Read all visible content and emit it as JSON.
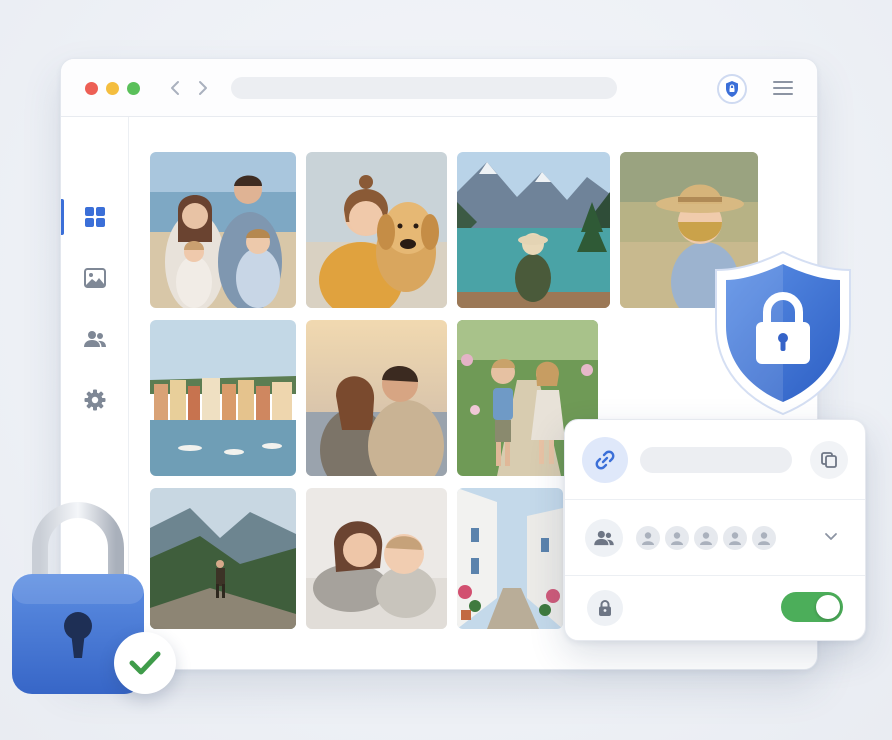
{
  "browser": {
    "traffic_lights": [
      "close",
      "minimize",
      "maximize"
    ],
    "traffic_light_colors": [
      "#ed5f55",
      "#f4be3f",
      "#5ac05a"
    ],
    "back_icon": "chevron-left-icon",
    "forward_icon": "chevron-right-icon",
    "address_text": "",
    "security_icon": "shield-lock-icon",
    "menu_icon": "hamburger-icon"
  },
  "sidebar": {
    "items": [
      {
        "icon": "grid-icon",
        "active": true
      },
      {
        "icon": "image-icon",
        "active": false
      },
      {
        "icon": "people-icon",
        "active": false
      },
      {
        "icon": "gear-icon",
        "active": false
      }
    ],
    "active_color": "#3b6fd8"
  },
  "gallery": {
    "photos": [
      {
        "subject": "family-on-beach"
      },
      {
        "subject": "girl-with-golden-retriever"
      },
      {
        "subject": "child-at-mountain-lake"
      },
      {
        "subject": "child-in-straw-hat-in-meadow"
      },
      {
        "subject": "coastal-village-harbor"
      },
      {
        "subject": "couple-at-sunset"
      },
      {
        "subject": "children-walking-on-garden-path"
      },
      {
        "subject": "hiker-on-mountain-ridge"
      },
      {
        "subject": "siblings-on-bed"
      },
      {
        "subject": "whitewashed-village-street"
      }
    ]
  },
  "share_panel": {
    "link_icon": "link-icon",
    "link_text": "",
    "copy_icon": "copy-icon",
    "people_icon": "people-icon",
    "avatar_count": 5,
    "expand_icon": "chevron-down-icon",
    "lock_icon": "lock-icon",
    "private_toggle_on": true,
    "toggle_color": "#4cae5a"
  },
  "decorations": {
    "shield_icon": "shield-padlock-icon",
    "padlock_icon": "padlock-icon",
    "check_icon": "checkmark-icon",
    "shield_color": "#3f74d6",
    "check_color": "#3f9c4a"
  }
}
